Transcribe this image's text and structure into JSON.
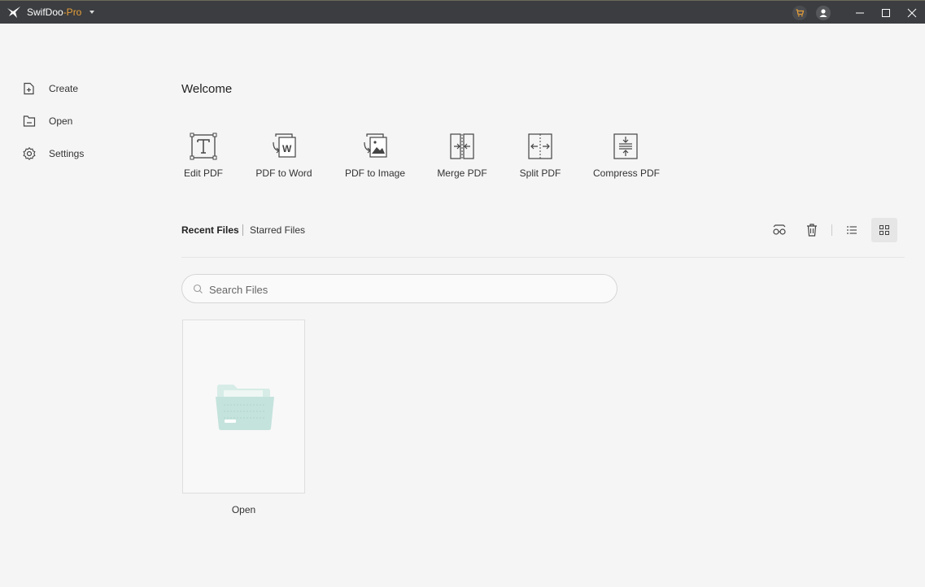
{
  "app": {
    "name": "SwifDoo",
    "edition": "-Pro"
  },
  "sidebar": {
    "items": [
      {
        "label": "Create",
        "icon": "create-icon"
      },
      {
        "label": "Open",
        "icon": "open-icon"
      },
      {
        "label": "Settings",
        "icon": "settings-icon"
      }
    ]
  },
  "main": {
    "welcome": "Welcome",
    "tools": [
      {
        "label": "Edit PDF",
        "icon": "edit-pdf-icon"
      },
      {
        "label": "PDF to Word",
        "icon": "pdf-to-word-icon"
      },
      {
        "label": "PDF to Image",
        "icon": "pdf-to-image-icon"
      },
      {
        "label": "Merge PDF",
        "icon": "merge-pdf-icon"
      },
      {
        "label": "Split PDF",
        "icon": "split-pdf-icon"
      },
      {
        "label": "Compress PDF",
        "icon": "compress-pdf-icon"
      }
    ],
    "tabs": [
      {
        "label": "Recent Files",
        "active": true
      },
      {
        "label": "Starred Files",
        "active": false
      }
    ],
    "search": {
      "placeholder": "Search Files",
      "value": ""
    },
    "open_card_label": "Open"
  },
  "colors": {
    "titlebar": "#3b3d40",
    "accent_pro": "#e8a03a",
    "folder": "#c4e3dc",
    "background": "#f5f5f5"
  }
}
